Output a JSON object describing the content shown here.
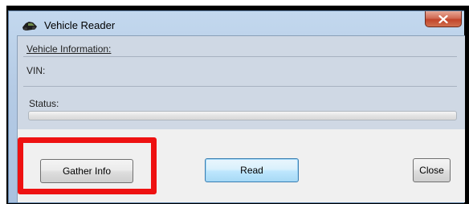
{
  "window": {
    "title": "Vehicle Reader",
    "icon": "car-icon",
    "close_icon": "close-icon"
  },
  "info": {
    "section_title": "Vehicle Information:",
    "vin_label": "VIN:",
    "status_label": "Status:",
    "progress_percent": 0
  },
  "buttons": {
    "gather_label": "Gather Info",
    "read_label": "Read",
    "close_label": "Close"
  },
  "annotation": {
    "highlight_color": "#ee1111",
    "highlighted_target": "Gather Info"
  }
}
